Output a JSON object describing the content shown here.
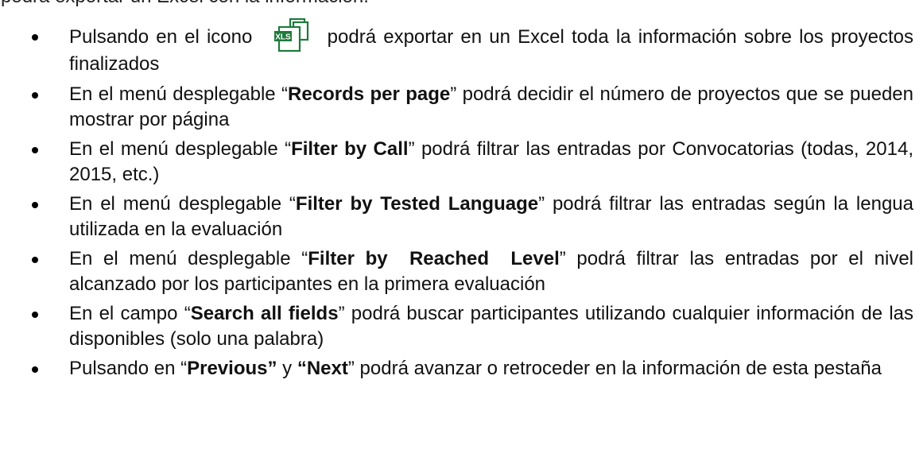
{
  "top_fragment": "podrá exportar un Excel con la información.",
  "icon": {
    "name": "xls-export-icon",
    "label": "XLS",
    "color": "#1f7a3c"
  },
  "bullets": [
    {
      "pre": "Pulsando en el icono",
      "post": "podrá exportar en un Excel toda la información sobre los proyectos finalizados"
    },
    {
      "pre": "En el menú desplegable “",
      "bold": "Records per page",
      "post": "” podrá decidir el número de proyectos que se pueden mostrar por página"
    },
    {
      "pre": "En el menú desplegable “",
      "bold": "Filter by Call",
      "post": "” podrá filtrar las entradas por Convocatorias (todas, 2014, 2015, etc.)"
    },
    {
      "pre": "En el menú desplegable “",
      "bold": "Filter by Tested Language",
      "post": "” podrá filtrar las entradas según la lengua utilizada en la evaluación"
    },
    {
      "pre": "En el menú desplegable “",
      "bold": "Filter by  Reached  Level",
      "post": "” podrá filtrar las entradas por el nivel alcanzado por los participantes en la primera evaluación"
    },
    {
      "pre": "En el campo “",
      "bold": "Search all fields",
      "post": "” podrá buscar participantes utilizando cualquier información de las disponibles (solo una palabra)"
    },
    {
      "pre": "Pulsando en “",
      "bold": "Previous”",
      "mid": " y ",
      "bold2": "“Next",
      "post": "” podrá avanzar o retroceder en la información de esta pestaña"
    }
  ]
}
